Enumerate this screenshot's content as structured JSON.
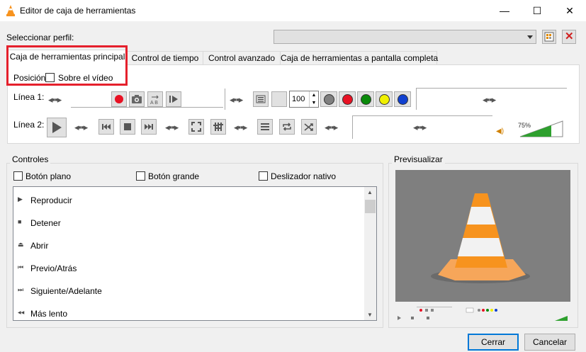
{
  "window": {
    "title": "Editor de caja de herramientas",
    "minimize": "—",
    "maximize": "☐",
    "close": "✕"
  },
  "profile": {
    "label": "Seleccionar perfil:",
    "value": ""
  },
  "tabs": [
    {
      "label": "Caja de herramientas principal",
      "active": true
    },
    {
      "label": "Control de tiempo",
      "active": false
    },
    {
      "label": "Control avanzado",
      "active": false
    },
    {
      "label": "Caja de herramientas a pantalla completa",
      "active": false
    }
  ],
  "position": {
    "label": "Posición",
    "checkbox_label": "Sobre el vídeo",
    "checked": false
  },
  "lines": {
    "line1_label": "Línea 1:",
    "line2_label": "Línea 2:",
    "spin_value": "100",
    "volume_percent": "75%"
  },
  "controls": {
    "title": "Controles",
    "flat_button": "Botón plano",
    "big_button": "Botón grande",
    "native_slider": "Deslizador nativo",
    "items": [
      {
        "label": "Reproducir",
        "icon": "play-icon",
        "glyph": "▶"
      },
      {
        "label": "Detener",
        "icon": "stop-icon",
        "glyph": "■"
      },
      {
        "label": "Abrir",
        "icon": "eject-icon",
        "glyph": "⏏"
      },
      {
        "label": "Previo/Atrás",
        "icon": "previous-icon",
        "glyph": "⏮"
      },
      {
        "label": "Siguiente/Adelante",
        "icon": "next-icon",
        "glyph": "⏭"
      },
      {
        "label": "Más lento",
        "icon": "slower-icon",
        "glyph": "◀◀"
      }
    ]
  },
  "preview": {
    "title": "Previsualizar"
  },
  "buttons": {
    "close": "Cerrar",
    "cancel": "Cancelar"
  },
  "colors": {
    "highlight": "#e5202c",
    "accent": "#0078d7",
    "record": "#e81123"
  }
}
